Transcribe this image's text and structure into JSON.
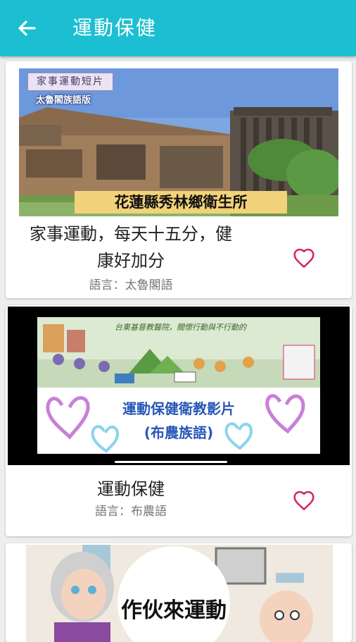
{
  "appbar": {
    "title": "運動保健",
    "back_icon": "arrow-back-icon"
  },
  "colors": {
    "appbar": "#1bbfd1",
    "heart": "#d62160",
    "background": "#eeeeee"
  },
  "videos": [
    {
      "thumbnail": {
        "tag": "家事運動短片",
        "language_badge": "太魯閣族語版",
        "caption": "花蓮縣秀林鄉衛生所"
      },
      "title_line1": "家事運動，每天十五分，健",
      "title_line2": "康好加分",
      "language_label": "語言",
      "language": "太魯閣語",
      "favorite_icon": "heart-outline-icon"
    },
    {
      "thumbnail": {
        "banner": "台東基督教醫院，關懷行動與不行動的",
        "heading": "運動保健衛教影片",
        "subheading": "(布農族語)"
      },
      "title_line1": "運動保健",
      "language_label": "語言",
      "language": "布農語",
      "favorite_icon": "heart-outline-icon"
    },
    {
      "thumbnail": {
        "heading": "作伙來運動"
      }
    }
  ]
}
